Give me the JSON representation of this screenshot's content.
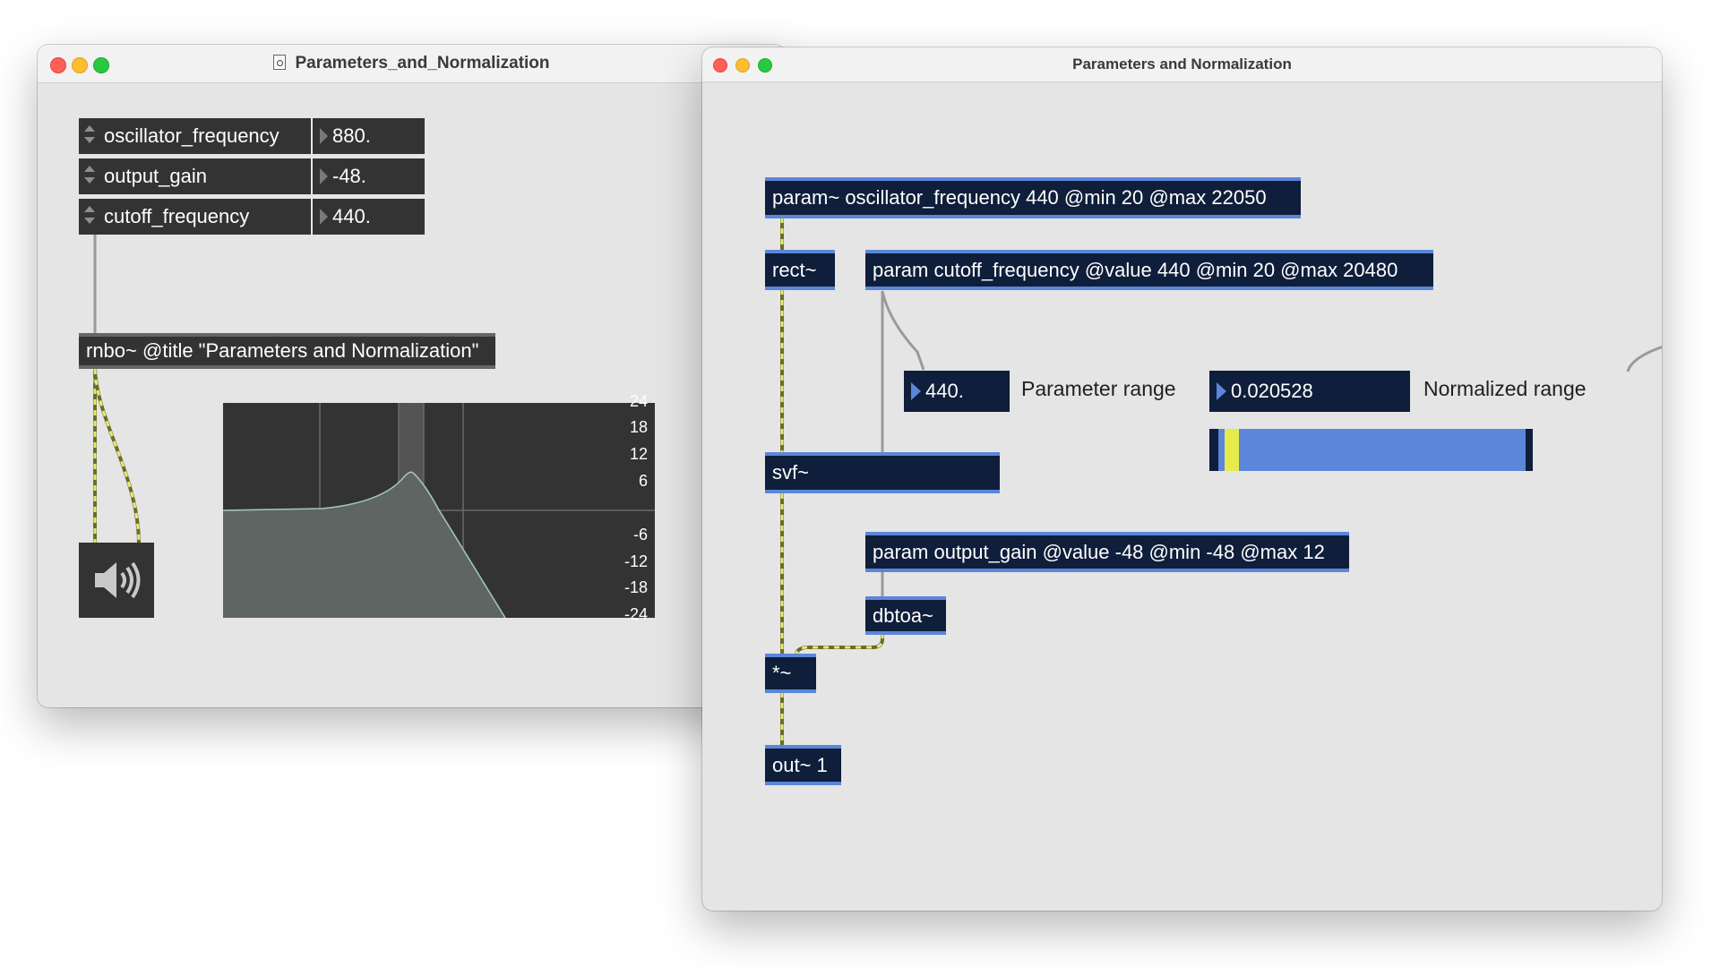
{
  "left_window": {
    "title": "Parameters_and_Normalization",
    "params": [
      {
        "name": "oscillator_frequency",
        "value": "880."
      },
      {
        "name": "output_gain",
        "value": "-48."
      },
      {
        "name": "cutoff_frequency",
        "value": "440."
      }
    ],
    "rnbo_object": "rnbo~ @title \"Parameters and Normalization\"",
    "speaker_icon": "speaker-icon",
    "filter_graph": {
      "ticks": [
        "24",
        "18",
        "12",
        "6",
        "-6",
        "-12",
        "-18",
        "-24"
      ]
    }
  },
  "right_window": {
    "title": "Parameters and Normalization",
    "objects": {
      "param_osc": "param~ oscillator_frequency 440 @min 20 @max 22050",
      "rect": "rect~",
      "param_cutoff": "param cutoff_frequency @value 440 @min 20 @max 20480",
      "svf": "svf~",
      "param_gain": "param output_gain @value -48 @min -48 @max 12",
      "dbtoa": "dbtoa~",
      "mult": "*~",
      "out": "out~ 1"
    },
    "number_parameter": "440.",
    "label_parameter_range": "Parameter range",
    "number_normalized": "0.020528",
    "label_normalized_range": "Normalized range",
    "normalized_slider_value": 0.020528
  },
  "colors": {
    "object_bg": "#0f1e3a",
    "object_inlet_bar": "#5b86d9",
    "signal_patchcord": "#c8d36a",
    "control_patchcord": "#9a9a9a",
    "slider_fill": "#5b86d9",
    "slider_knob": "#e7ea4c"
  }
}
